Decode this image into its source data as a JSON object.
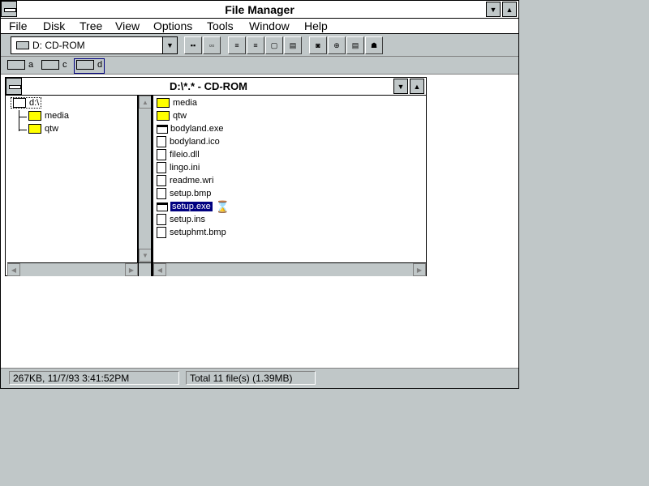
{
  "window": {
    "title": "File Manager"
  },
  "menu": [
    "File",
    "Disk",
    "Tree",
    "View",
    "Options",
    "Tools",
    "Window",
    "Help"
  ],
  "toolbar": {
    "drive_selected": "D: CD-ROM"
  },
  "drives": [
    "a",
    "c",
    "d"
  ],
  "child": {
    "title": "D:\\*.* - CD-ROM",
    "tree": [
      {
        "label": "d:\\",
        "type": "open-folder"
      },
      {
        "label": "media",
        "type": "folder"
      },
      {
        "label": "qtw",
        "type": "folder"
      }
    ],
    "files": [
      {
        "name": "media",
        "type": "folder"
      },
      {
        "name": "qtw",
        "type": "folder"
      },
      {
        "name": "bodyland.exe",
        "type": "exe"
      },
      {
        "name": "bodyland.ico",
        "type": "file"
      },
      {
        "name": "fileio.dll",
        "type": "file"
      },
      {
        "name": "lingo.ini",
        "type": "file"
      },
      {
        "name": "readme.wri",
        "type": "file"
      },
      {
        "name": "setup.bmp",
        "type": "file"
      },
      {
        "name": "setup.exe",
        "type": "exe",
        "selected": true
      },
      {
        "name": "setup.ins",
        "type": "file"
      },
      {
        "name": "setuphmt.bmp",
        "type": "file"
      }
    ]
  },
  "status": {
    "left": "267KB, 11/7/93 3:41:52PM",
    "right": "Total 11 file(s) (1.39MB)"
  }
}
